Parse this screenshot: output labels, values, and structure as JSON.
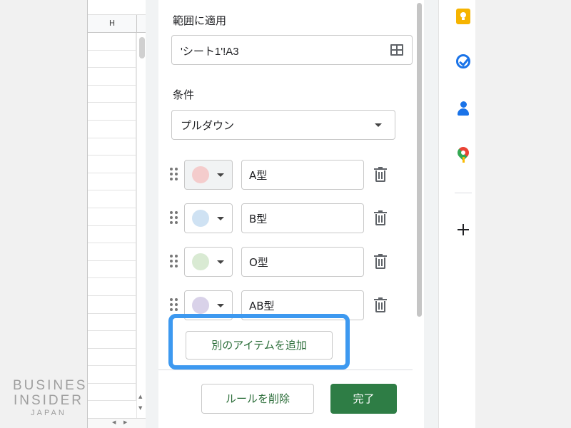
{
  "watermark": {
    "line1": "BUSINESS",
    "line2": "INSIDER",
    "line3": "JAPAN"
  },
  "sheet": {
    "column_label": "H"
  },
  "panel": {
    "range_label": "範囲に適用",
    "range_value": "'シート1'!A3",
    "condition_label": "条件",
    "condition_value": "プルダウン",
    "items": [
      {
        "value": "A型",
        "color": "#f4cccc"
      },
      {
        "value": "B型",
        "color": "#cfe2f3"
      },
      {
        "value": "O型",
        "color": "#d9ead3"
      },
      {
        "value": "AB型",
        "color": "#d9d2e9"
      }
    ],
    "add_item_label": "別のアイテムを追加",
    "delete_rule_label": "ルールを削除",
    "done_label": "完了"
  },
  "colors": {
    "accent": "#2e7d45",
    "highlight": "#3d99f0"
  }
}
